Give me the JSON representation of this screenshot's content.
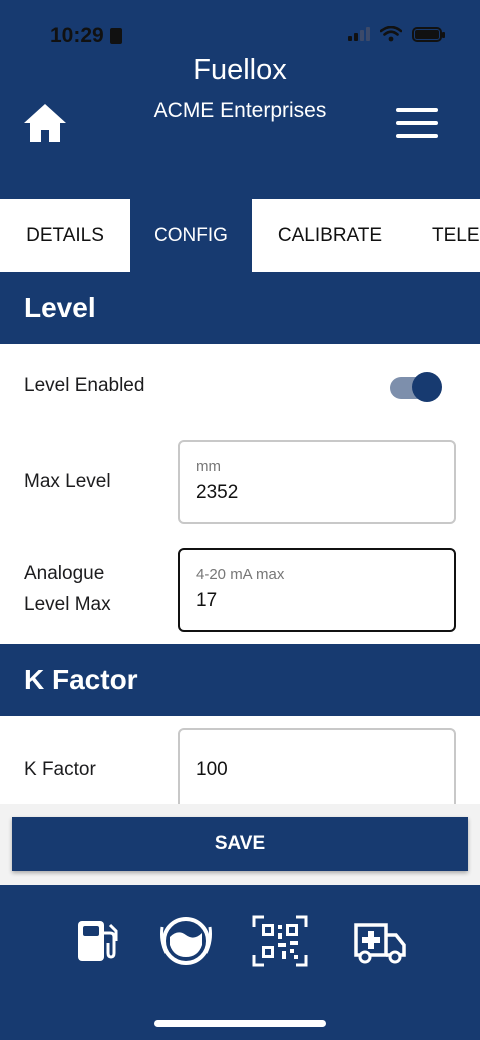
{
  "status_bar": {
    "time": "10:29"
  },
  "header": {
    "title": "Fuellox",
    "subtitle": "ACME Enterprises",
    "home_icon": "home-icon",
    "menu_icon": "hamburger-menu-icon"
  },
  "tabs": [
    {
      "label": "DETAILS",
      "active": false
    },
    {
      "label": "CONFIG",
      "active": true
    },
    {
      "label": "CALIBRATE",
      "active": false
    },
    {
      "label": "TELE",
      "active": false
    }
  ],
  "level_section": {
    "title": "Level",
    "enabled_label": "Level Enabled",
    "enabled": true,
    "max_level": {
      "label": "Max Level",
      "unit_label": "mm",
      "value": "2352"
    },
    "analogue": {
      "label_line1": "Analogue",
      "label_line2": "Level Max",
      "unit_label": "4-20 mA max",
      "value": "17"
    }
  },
  "k_factor_section": {
    "title": "K Factor",
    "field": {
      "label": "K Factor",
      "value": "100"
    }
  },
  "save_label": "SAVE",
  "bottom_nav": [
    {
      "icon": "fuel-pump-icon"
    },
    {
      "icon": "tank-gauge-icon"
    },
    {
      "icon": "qr-code-icon"
    },
    {
      "icon": "ambulance-icon"
    }
  ],
  "colors": {
    "primary": "#173a70",
    "toggle_track": "#7d8fac",
    "field_border": "#c8c8c8"
  }
}
